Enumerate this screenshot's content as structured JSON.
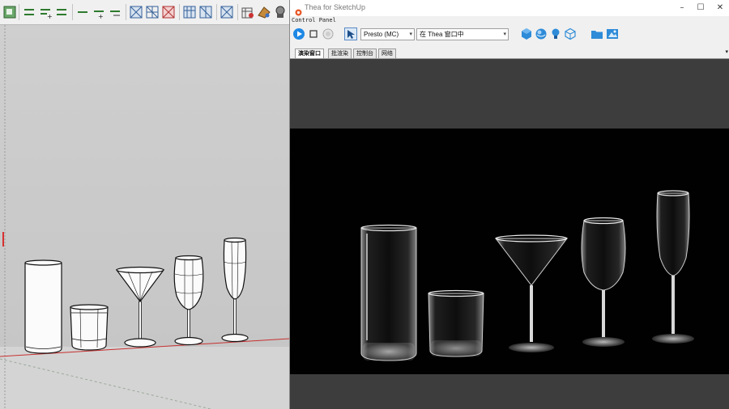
{
  "sketchup": {
    "toolbar_icons": [
      "style-icon",
      "edge-icon",
      "edge-plus-icon",
      "edge-minus-icon",
      "line-icon",
      "line-plus-icon",
      "line-minus-icon",
      "xray-icon",
      "wireframe-icon",
      "hidden-line-icon",
      "section-plane-icon",
      "section-cut-icon",
      "section-fill-icon",
      "model-info-icon",
      "texture-icon",
      "component-icon"
    ]
  },
  "thea": {
    "window_title": "Thea for SketchUp",
    "panel_label": "Control Panel",
    "engine_select": "Presto (MC)",
    "target_select": "在 Thea 窗口中",
    "tabs": [
      "演染窗口",
      "批渲染",
      "控制台",
      "网络"
    ],
    "active_tab": 0,
    "colors": {
      "accent": "#1e88e5",
      "render_bg": "#010101",
      "frame_bg": "#3d3d3d"
    }
  }
}
